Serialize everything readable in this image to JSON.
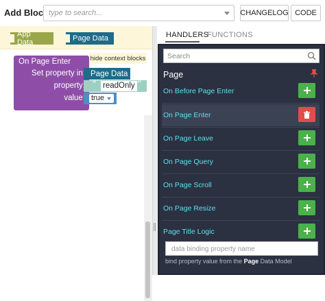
{
  "toolbar": {
    "add_block_label": "Add Block:",
    "search_placeholder": "type to search...",
    "changelog_label": "CHANGELOG",
    "code_label": "CODE"
  },
  "workspace": {
    "context_blocks": [
      {
        "label": "App Data",
        "color": "#9aa64a"
      },
      {
        "label": "Page Data",
        "color": "#1e6b8a"
      }
    ],
    "hide_context_label": "hide context blocks",
    "event_block": {
      "label": "On Page Enter",
      "set_property_in": "Set property in:",
      "property_label": "property:",
      "value_label": "value:",
      "target": "Page Data",
      "property_value": "readOnly",
      "value": "true"
    }
  },
  "panel": {
    "tabs": [
      {
        "label": "HANDLERS",
        "active": true
      },
      {
        "label": "FUNCTIONS",
        "active": false
      }
    ],
    "search_placeholder": "Search",
    "section_title": "Page",
    "handlers": [
      {
        "label": "On Before Page Enter",
        "action": "add",
        "active": false
      },
      {
        "label": "On Page Enter",
        "action": "delete",
        "active": true
      },
      {
        "label": "On Page Leave",
        "action": "add",
        "active": false
      },
      {
        "label": "On Page Query",
        "action": "add",
        "active": false
      },
      {
        "label": "On Page Scroll",
        "action": "add",
        "active": false
      },
      {
        "label": "On Page Resize",
        "action": "add",
        "active": false
      },
      {
        "label": "Page Title Logic",
        "action": "add",
        "active": false
      }
    ],
    "binding_placeholder": "data binding property name",
    "binding_help_prefix": "bind property value from the",
    "binding_help_bold": "Page",
    "binding_help_suffix": "Data Model"
  },
  "colors": {
    "accent_cyan": "#5ee0f0",
    "add_green": "#49b24a",
    "delete_red": "#e34c4c",
    "panel_bg": "#2b3140",
    "event_purple": "#8e4ea8"
  }
}
